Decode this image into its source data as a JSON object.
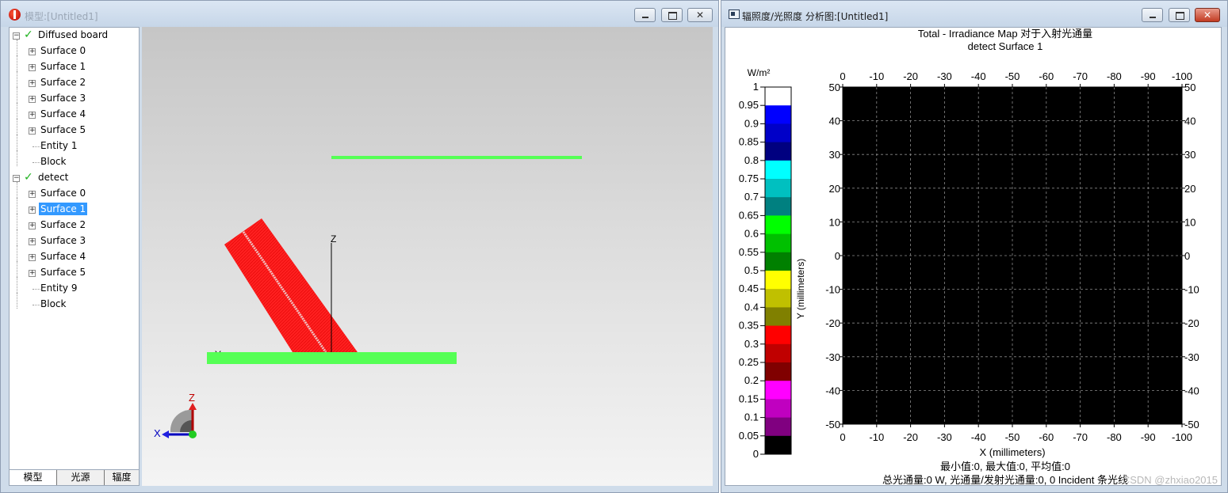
{
  "model_window": {
    "title": "模型:[Untitled1]",
    "tree": [
      {
        "label": "Diffused board",
        "level": 0,
        "checked": true,
        "expander": "-"
      },
      {
        "label": "Surface 0",
        "level": 1,
        "expander": "+"
      },
      {
        "label": "Surface 1",
        "level": 1,
        "expander": "+"
      },
      {
        "label": "Surface 2",
        "level": 1,
        "expander": "+"
      },
      {
        "label": "Surface 3",
        "level": 1,
        "expander": "+"
      },
      {
        "label": "Surface 4",
        "level": 1,
        "expander": "+"
      },
      {
        "label": "Surface 5",
        "level": 1,
        "expander": "+"
      },
      {
        "label": "Entity 1",
        "level": 1,
        "expander": ""
      },
      {
        "label": "Block",
        "level": 1,
        "expander": ""
      },
      {
        "label": "detect",
        "level": 0,
        "checked": true,
        "expander": "-"
      },
      {
        "label": "Surface 0",
        "level": 1,
        "expander": "+"
      },
      {
        "label": "Surface 1",
        "level": 1,
        "expander": "+",
        "selected": true
      },
      {
        "label": "Surface 2",
        "level": 1,
        "expander": "+"
      },
      {
        "label": "Surface 3",
        "level": 1,
        "expander": "+"
      },
      {
        "label": "Surface 4",
        "level": 1,
        "expander": "+"
      },
      {
        "label": "Surface 5",
        "level": 1,
        "expander": "+"
      },
      {
        "label": "Entity 9",
        "level": 1,
        "expander": ""
      },
      {
        "label": "Block",
        "level": 1,
        "expander": ""
      }
    ],
    "tabs": [
      "模型",
      "光源",
      "辐度"
    ],
    "view": {
      "axis_z_label": "Z",
      "axis_y_label": "Y",
      "triad_z": "Z",
      "triad_x": "X",
      "colors": {
        "board": "#55ff55",
        "source": "#ff1a1a",
        "background_top": "#c6c6c6"
      }
    }
  },
  "map_window": {
    "title": "辐照度/光照度 分析图:[Untitled1]",
    "plot_title": "Total - Irradiance Map 对于入射光通量",
    "plot_subtitle": "detect Surface 1",
    "colorbar_unit": "W/m²",
    "colorbar_ticks": [
      "1",
      "0.95",
      "0.9",
      "0.85",
      "0.8",
      "0.75",
      "0.7",
      "0.65",
      "0.6",
      "0.55",
      "0.5",
      "0.45",
      "0.4",
      "0.35",
      "0.3",
      "0.25",
      "0.2",
      "0.15",
      "0.1",
      "0.05",
      "0"
    ],
    "colorbar_colors": [
      "#ffffff",
      "#0000ff",
      "#0000c8",
      "#000080",
      "#00ffff",
      "#00c0c0",
      "#008080",
      "#00ff00",
      "#00c000",
      "#008000",
      "#ffff00",
      "#c0c000",
      "#808000",
      "#ff0000",
      "#c00000",
      "#800000",
      "#ff00ff",
      "#c000c0",
      "#800080",
      "#000000"
    ],
    "ylabel": "Y (millimeters)",
    "xlabel": "X (millimeters)",
    "stats_line": "最小值:0, 最大值:0, 平均值:0",
    "total_line": "总光通量:0 W, 光通量/发射光通量:0, 0 Incident 条光线",
    "watermark": "CSDN @zhxiao2015"
  },
  "chart_data": {
    "type": "heatmap",
    "title": "Total - Irradiance Map 对于入射光通量",
    "subtitle": "detect Surface 1",
    "xlabel": "X (millimeters)",
    "ylabel": "Y (millimeters)",
    "x_ticks": [
      "0",
      "-10",
      "-20",
      "-30",
      "-40",
      "-50",
      "-60",
      "-70",
      "-80",
      "-90",
      "-100"
    ],
    "y_ticks": [
      "50",
      "40",
      "30",
      "20",
      "10",
      "0",
      "-10",
      "-20",
      "-30",
      "-40",
      "-50"
    ],
    "xlim": [
      0,
      -100
    ],
    "ylim": [
      -50,
      50
    ],
    "values": "all zero (uniform black field)",
    "min": 0,
    "max": 0,
    "mean": 0,
    "grid": true,
    "colorbar_range": [
      0,
      1
    ]
  }
}
